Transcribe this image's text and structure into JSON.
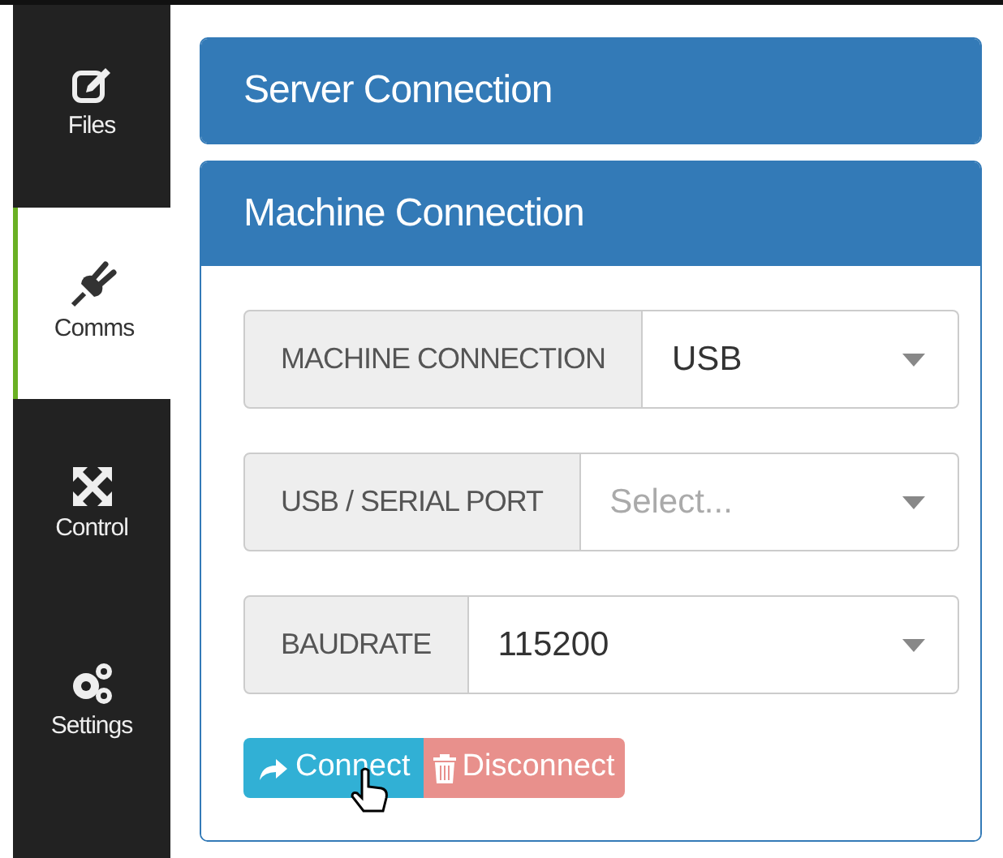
{
  "sidebar": {
    "items": [
      {
        "label": "Files",
        "selected": false
      },
      {
        "label": "Comms",
        "selected": true
      },
      {
        "label": "Control",
        "selected": false
      },
      {
        "label": "Settings",
        "selected": false
      }
    ]
  },
  "panels": [
    {
      "title": "Server Connection",
      "expanded": false
    },
    {
      "title": "Machine Connection",
      "expanded": true,
      "fields": [
        {
          "label": "MACHINE CONNECTION",
          "value": "USB"
        },
        {
          "label": "USB / SERIAL PORT",
          "placeholder": "Select..."
        },
        {
          "label": "BAUDRATE",
          "value": "115200"
        }
      ],
      "buttons": [
        {
          "kind": "connect",
          "label": "Connect"
        },
        {
          "kind": "disconnect",
          "label": "Disconnect"
        }
      ]
    }
  ]
}
